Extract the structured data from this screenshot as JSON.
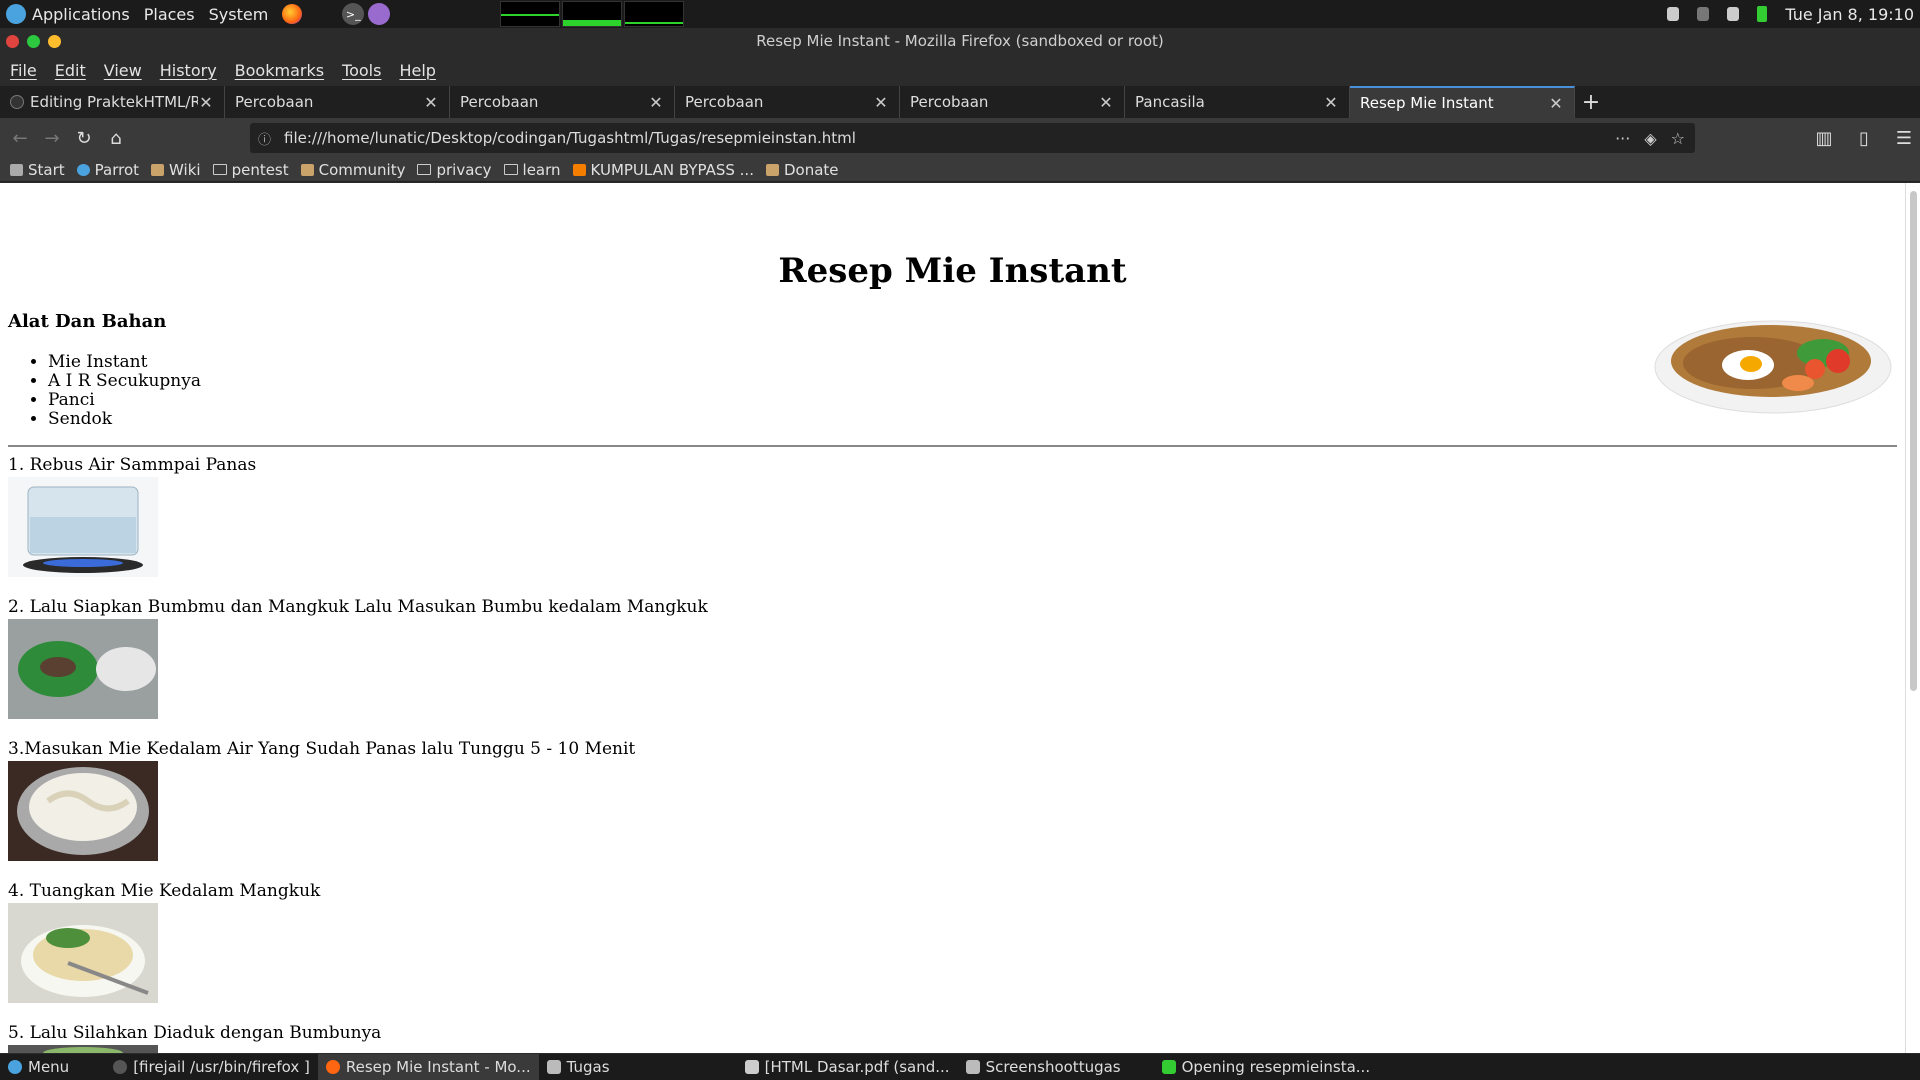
{
  "system_panel": {
    "applications": "Applications",
    "places": "Places",
    "system": "System",
    "clock": "Tue Jan  8, 19:10"
  },
  "window": {
    "title": "Resep Mie Instant - Mozilla Firefox (sandboxed or root)"
  },
  "menu": [
    "File",
    "Edit",
    "View",
    "History",
    "Bookmarks",
    "Tools",
    "Help"
  ],
  "tabs": [
    {
      "label": "Editing PraktekHTML/RE",
      "active": false
    },
    {
      "label": "Percobaan",
      "active": false
    },
    {
      "label": "Percobaan",
      "active": false
    },
    {
      "label": "Percobaan",
      "active": false
    },
    {
      "label": "Percobaan",
      "active": false
    },
    {
      "label": "Pancasila",
      "active": false
    },
    {
      "label": "Resep Mie Instant",
      "active": true
    }
  ],
  "address": {
    "url": "file:///home/lunatic/Desktop/codingan/Tugashtml/Tugas/resepmieinstan.html"
  },
  "bookmarks": [
    "Start",
    "Parrot",
    "Wiki",
    "pentest",
    "Community",
    "privacy",
    "learn",
    "KUMPULAN BYPASS ...",
    "Donate"
  ],
  "page": {
    "title": "Resep Mie Instant",
    "section_heading": "Alat Dan Bahan",
    "tools": [
      "Mie Instant",
      "A I R Secukupnya",
      "Panci",
      "Sendok"
    ],
    "steps": [
      "1. Rebus Air Sammpai Panas",
      "2. Lalu Siapkan Bumbmu dan Mangkuk Lalu Masukan Bumbu kedalam Mangkuk",
      "3.Masukan Mie Kedalam Air Yang Sudah Panas lalu Tunggu 5 - 10 Menit",
      "4. Tuangkan Mie Kedalam Mangkuk",
      "5. Lalu Silahkan Diaduk dengan Bumbunya"
    ]
  },
  "taskbar": {
    "menu": "Menu",
    "items": [
      {
        "label": "[firejail /usr/bin/firefox ]",
        "active": false
      },
      {
        "label": "Resep Mie Instant - Mo...",
        "active": true
      },
      {
        "label": "Tugas",
        "active": false
      },
      {
        "label": "[HTML Dasar.pdf (sand...",
        "active": false
      },
      {
        "label": "Screenshoottugas",
        "active": false
      },
      {
        "label": "Opening resepmieinsta...",
        "active": false
      }
    ]
  }
}
